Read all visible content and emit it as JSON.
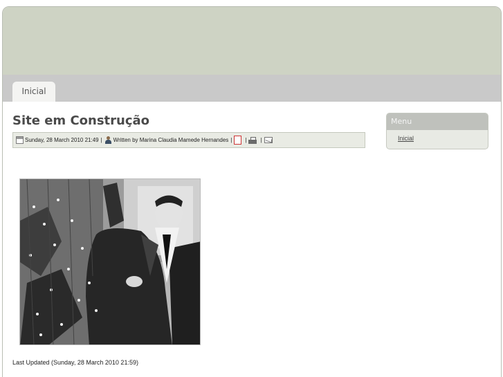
{
  "nav": {
    "tabs": [
      {
        "label": "Inicial"
      }
    ]
  },
  "article": {
    "title": "Site em Construção",
    "meta": {
      "date": "Sunday, 28 March 2010 21:49",
      "author_text": "Written by Marina Claudia Mamede Hernandes",
      "separator": "|",
      "icons": [
        "calendar-icon",
        "user-icon",
        "pdf-icon",
        "print-icon",
        "email-icon"
      ]
    },
    "image": {
      "subject": "black-and-white photo"
    },
    "last_updated": "Last Updated (Sunday, 28 March 2010 21:59)"
  },
  "sidebar": {
    "menu": {
      "title": "Menu",
      "items": [
        {
          "label": "Inicial"
        }
      ]
    }
  },
  "colors": {
    "banner": "#ced3c4",
    "navbar": "#c9c9c9",
    "meta_bg": "#e9ebe4",
    "menu_head": "#bfc1bc"
  }
}
